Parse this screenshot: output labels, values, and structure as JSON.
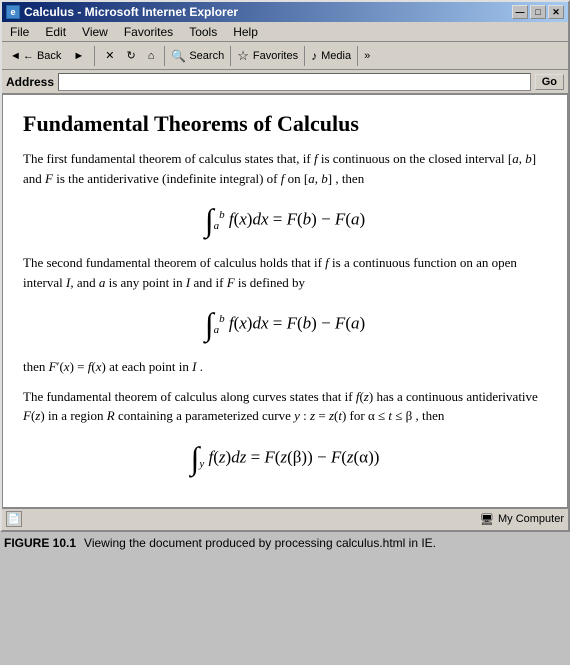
{
  "window": {
    "title": "Calculus - Microsoft Internet Explorer",
    "icon": "e"
  },
  "titlebar": {
    "minimize": "—",
    "maximize": "□",
    "close": "✕"
  },
  "menubar": {
    "items": [
      "File",
      "Edit",
      "View",
      "Favorites",
      "Tools",
      "Help"
    ]
  },
  "toolbar": {
    "back": "← Back",
    "forward": "→",
    "stop": "✕",
    "refresh": "↻",
    "home": "🏠",
    "search_label": "Search",
    "favorites_label": "Favorites",
    "media_label": "Media"
  },
  "addressbar": {
    "label": "Address",
    "value": "",
    "go": "Go"
  },
  "page": {
    "title": "Fundamental Theorems of Calculus",
    "paragraph1": "The first fundamental theorem of calculus states that, if f is continuous on the closed interval [a, b] and F is the antiderivative (indefinite integral) of f on [a, b] , then",
    "formula1_display": "∫_a^b f(x)dx = F(b) − F(a)",
    "paragraph2": "The second fundamental theorem of calculus holds that if f is a continuous function on an open interval I, and a is any point in I and if F is defined by",
    "formula2_display": "∫_a^b f(x)dx = F(b) − F(a)",
    "paragraph3": "then F′(x) = f(x) at each point in I.",
    "paragraph4": "The fundamental theorem of calculus along curves states that if f(z) has a continuous antiderivative F(z) in a region R containing a parameterized curve y : z = z(t) for α ≤ t ≤ β , then",
    "formula3_display": "∫_y f(z)dz = F(z(β)) − F(z(α))"
  },
  "statusbar": {
    "indicator": "●",
    "computer": "My Computer"
  },
  "caption": {
    "label": "FIGURE 10.1",
    "text": "Viewing the document produced by processing calculus.html in IE."
  }
}
